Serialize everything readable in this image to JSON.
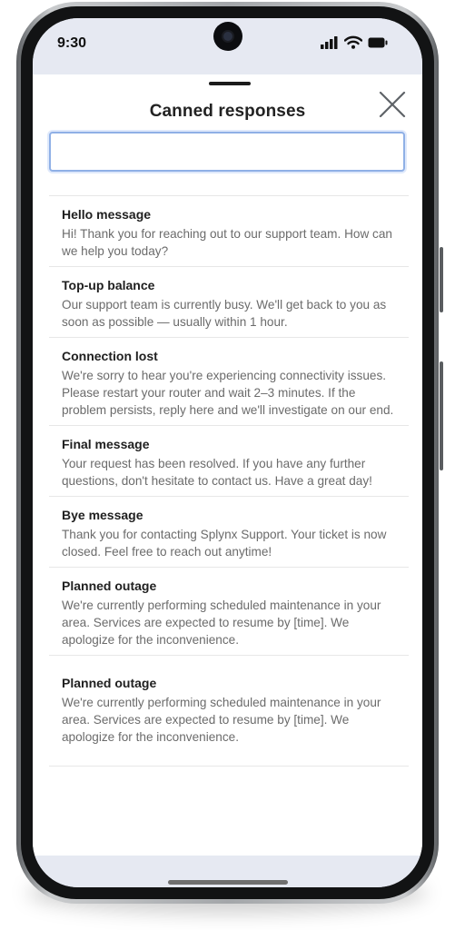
{
  "status_bar": {
    "time": "9:30"
  },
  "sheet": {
    "title": "Canned responses",
    "search": {
      "value": "",
      "placeholder": ""
    },
    "responses": [
      {
        "title": "Hello message",
        "text": "Hi! Thank you for reaching out to our support team. How can we help you today?"
      },
      {
        "title": "Top-up balance",
        "text": "Our support team is currently busy. We'll get back to you as soon as possible — usually within 1 hour."
      },
      {
        "title": "Connection lost",
        "text": "We're sorry to hear you're experiencing connectivity issues. Please restart your router and wait 2–3 minutes. If the problem persists, reply here and we'll investigate on our end."
      },
      {
        "title": "Final message",
        "text": "Your request has been resolved. If you have any further questions, don't hesitate to contact us. Have a great day!"
      },
      {
        "title": "Bye message",
        "text": "Thank you for contacting Splynx Support. Your ticket is now closed. Feel free to reach out anytime!"
      },
      {
        "title": "Planned outage",
        "text": "We're currently performing scheduled maintenance in your area. Services are expected to resume by [time]. We apologize for the inconvenience."
      },
      {
        "title": "Planned outage",
        "text": "We're currently performing scheduled maintenance in your area. Services are expected to resume by [time]. We apologize for the inconvenience."
      }
    ]
  },
  "icons": {
    "signal": "cellular-signal-icon",
    "wifi": "wifi-icon",
    "battery": "battery-icon",
    "close": "close-icon",
    "camera": "front-camera-icon"
  },
  "colors": {
    "screen_background": "#e6e9f2",
    "search_focus_border": "#8fb0e6",
    "title_text": "#222222",
    "body_text": "#6b6b6b"
  }
}
